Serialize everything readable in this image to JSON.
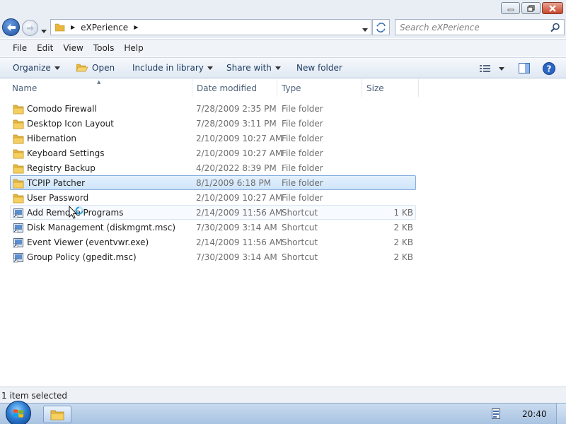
{
  "window": {
    "minimize_icon": "minimize-icon",
    "maximize_icon": "restore-icon",
    "close_icon": "close-icon"
  },
  "address": {
    "crumb": "eXPerience",
    "search_placeholder": "Search eXPerience"
  },
  "menu": {
    "file": "File",
    "edit": "Edit",
    "view": "View",
    "tools": "Tools",
    "help": "Help"
  },
  "toolbar": {
    "organize": "Organize",
    "open": "Open",
    "include_in_library": "Include in library",
    "share_with": "Share with",
    "new_folder": "New folder"
  },
  "columns": {
    "name": "Name",
    "date_modified": "Date modified",
    "type": "Type",
    "size": "Size"
  },
  "files": [
    {
      "name": "Comodo Firewall",
      "date": "7/28/2009 2:35 PM",
      "type": "File folder",
      "size": "",
      "icon": "folder-icon"
    },
    {
      "name": "Desktop Icon Layout",
      "date": "7/28/2009 3:11 PM",
      "type": "File folder",
      "size": "",
      "icon": "folder-icon"
    },
    {
      "name": "Hibernation",
      "date": "2/10/2009 10:27 AM",
      "type": "File folder",
      "size": "",
      "icon": "folder-icon"
    },
    {
      "name": "Keyboard Settings",
      "date": "2/10/2009 10:27 AM",
      "type": "File folder",
      "size": "",
      "icon": "folder-icon"
    },
    {
      "name": "Registry Backup",
      "date": "4/20/2022 8:39 PM",
      "type": "File folder",
      "size": "",
      "icon": "folder-icon"
    },
    {
      "name": "TCPIP Patcher",
      "date": "8/1/2009 6:18 PM",
      "type": "File folder",
      "size": "",
      "icon": "folder-icon"
    },
    {
      "name": "User Password",
      "date": "2/10/2009 10:27 AM",
      "type": "File folder",
      "size": "",
      "icon": "folder-icon"
    },
    {
      "name": "Add Remove Programs",
      "date": "2/14/2009 11:56 AM",
      "type": "Shortcut",
      "size": "1 KB",
      "icon": "shortcut-icon"
    },
    {
      "name": "Disk Management (diskmgmt.msc)",
      "date": "7/30/2009 3:14 AM",
      "type": "Shortcut",
      "size": "2 KB",
      "icon": "shortcut-icon"
    },
    {
      "name": "Event Viewer (eventvwr.exe)",
      "date": "2/14/2009 11:56 AM",
      "type": "Shortcut",
      "size": "2 KB",
      "icon": "shortcut-icon"
    },
    {
      "name": "Group Policy (gpedit.msc)",
      "date": "7/30/2009 3:14 AM",
      "type": "Shortcut",
      "size": "2 KB",
      "icon": "shortcut-icon"
    }
  ],
  "status": {
    "text": "1 item selected"
  },
  "taskbar": {
    "clock": "20:40"
  },
  "colors": {
    "selection_border": "#84acdd",
    "selection_fill": "#cfe5fb",
    "folder": "#e8b73c",
    "chrome": "#e9eef5"
  }
}
